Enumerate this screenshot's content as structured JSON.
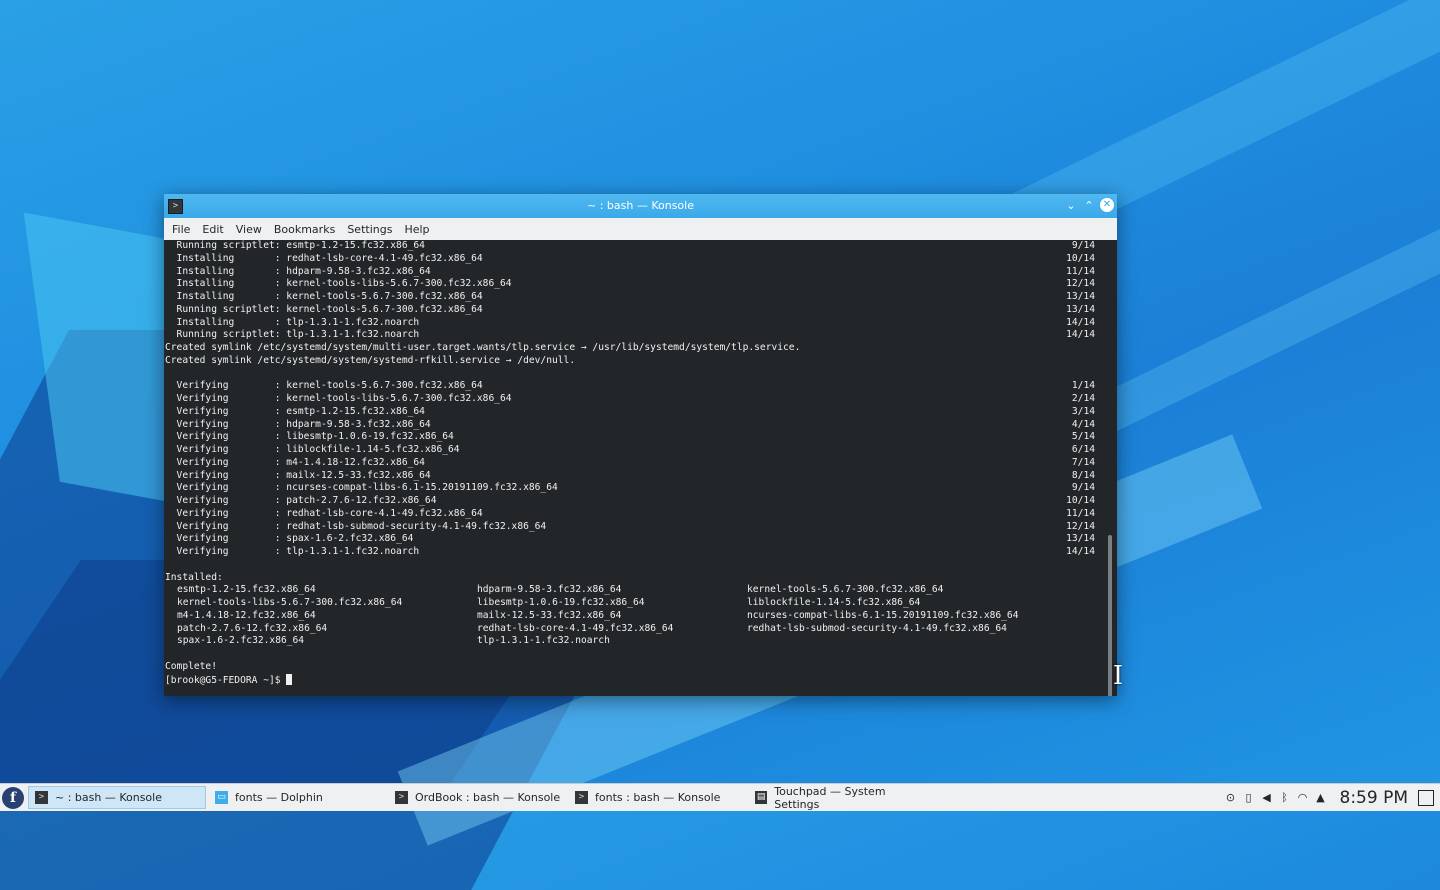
{
  "window": {
    "title": "~ : bash — Konsole",
    "app_icon": ">",
    "buttons": {
      "minimize": "⌄",
      "maximize": "⌃",
      "close": "✕"
    }
  },
  "menubar": [
    "File",
    "Edit",
    "View",
    "Bookmarks",
    "Settings",
    "Help"
  ],
  "terminal": {
    "lines": [
      {
        "text": "  Running scriptlet: esmtp-1.2-15.fc32.x86_64",
        "right": "9/14"
      },
      {
        "text": "  Installing       : redhat-lsb-core-4.1-49.fc32.x86_64",
        "right": "10/14"
      },
      {
        "text": "  Installing       : hdparm-9.58-3.fc32.x86_64",
        "right": "11/14"
      },
      {
        "text": "  Installing       : kernel-tools-libs-5.6.7-300.fc32.x86_64",
        "right": "12/14"
      },
      {
        "text": "  Installing       : kernel-tools-5.6.7-300.fc32.x86_64",
        "right": "13/14"
      },
      {
        "text": "  Running scriptlet: kernel-tools-5.6.7-300.fc32.x86_64",
        "right": "13/14"
      },
      {
        "text": "  Installing       : tlp-1.3.1-1.fc32.noarch",
        "right": "14/14"
      },
      {
        "text": "  Running scriptlet: tlp-1.3.1-1.fc32.noarch",
        "right": "14/14"
      },
      {
        "text": "Created symlink /etc/systemd/system/multi-user.target.wants/tlp.service → /usr/lib/systemd/system/tlp.service.",
        "right": ""
      },
      {
        "text": "Created symlink /etc/systemd/system/systemd-rfkill.service → /dev/null.",
        "right": ""
      },
      {
        "text": "",
        "right": ""
      },
      {
        "text": "  Verifying        : kernel-tools-5.6.7-300.fc32.x86_64",
        "right": "1/14"
      },
      {
        "text": "  Verifying        : kernel-tools-libs-5.6.7-300.fc32.x86_64",
        "right": "2/14"
      },
      {
        "text": "  Verifying        : esmtp-1.2-15.fc32.x86_64",
        "right": "3/14"
      },
      {
        "text": "  Verifying        : hdparm-9.58-3.fc32.x86_64",
        "right": "4/14"
      },
      {
        "text": "  Verifying        : libesmtp-1.0.6-19.fc32.x86_64",
        "right": "5/14"
      },
      {
        "text": "  Verifying        : liblockfile-1.14-5.fc32.x86_64",
        "right": "6/14"
      },
      {
        "text": "  Verifying        : m4-1.4.18-12.fc32.x86_64",
        "right": "7/14"
      },
      {
        "text": "  Verifying        : mailx-12.5-33.fc32.x86_64",
        "right": "8/14"
      },
      {
        "text": "  Verifying        : ncurses-compat-libs-6.1-15.20191109.fc32.x86_64",
        "right": "9/14"
      },
      {
        "text": "  Verifying        : patch-2.7.6-12.fc32.x86_64",
        "right": "10/14"
      },
      {
        "text": "  Verifying        : redhat-lsb-core-4.1-49.fc32.x86_64",
        "right": "11/14"
      },
      {
        "text": "  Verifying        : redhat-lsb-submod-security-4.1-49.fc32.x86_64",
        "right": "12/14"
      },
      {
        "text": "  Verifying        : spax-1.6-2.fc32.x86_64",
        "right": "13/14"
      },
      {
        "text": "  Verifying        : tlp-1.3.1-1.fc32.noarch",
        "right": "14/14"
      },
      {
        "text": "",
        "right": ""
      },
      {
        "text": "Installed:",
        "right": ""
      }
    ],
    "installed": [
      [
        "esmtp-1.2-15.fc32.x86_64",
        "hdparm-9.58-3.fc32.x86_64",
        "kernel-tools-5.6.7-300.fc32.x86_64"
      ],
      [
        "kernel-tools-libs-5.6.7-300.fc32.x86_64",
        "libesmtp-1.0.6-19.fc32.x86_64",
        "liblockfile-1.14-5.fc32.x86_64"
      ],
      [
        "m4-1.4.18-12.fc32.x86_64",
        "mailx-12.5-33.fc32.x86_64",
        "ncurses-compat-libs-6.1-15.20191109.fc32.x86_64"
      ],
      [
        "patch-2.7.6-12.fc32.x86_64",
        "redhat-lsb-core-4.1-49.fc32.x86_64",
        "redhat-lsb-submod-security-4.1-49.fc32.x86_64"
      ],
      [
        "spax-1.6-2.fc32.x86_64",
        "tlp-1.3.1-1.fc32.noarch",
        ""
      ]
    ],
    "complete": "Complete!",
    "prompt": "[brook@G5-FEDORA ~]$ "
  },
  "taskbar": {
    "launcher_icon": "f",
    "tasks": [
      {
        "label": "~ : bash — Konsole",
        "icon": "konsole-icon",
        "glyph": ">",
        "active": true
      },
      {
        "label": "fonts — Dolphin",
        "icon": "folder-icon",
        "glyph": "▭",
        "active": false
      },
      {
        "label": "OrdBook : bash — Konsole",
        "icon": "konsole-icon",
        "glyph": ">",
        "active": false
      },
      {
        "label": "fonts : bash — Konsole",
        "icon": "konsole-icon",
        "glyph": ">",
        "active": false
      },
      {
        "label": "Touchpad  — System Settings",
        "icon": "settings-icon",
        "glyph": "▤",
        "active": false
      }
    ],
    "tray_icons": [
      "updates-icon",
      "clipboard-icon",
      "volume-icon",
      "bluetooth-icon",
      "wifi-icon",
      "tray-expand-icon"
    ],
    "clock": "8:59 PM"
  }
}
